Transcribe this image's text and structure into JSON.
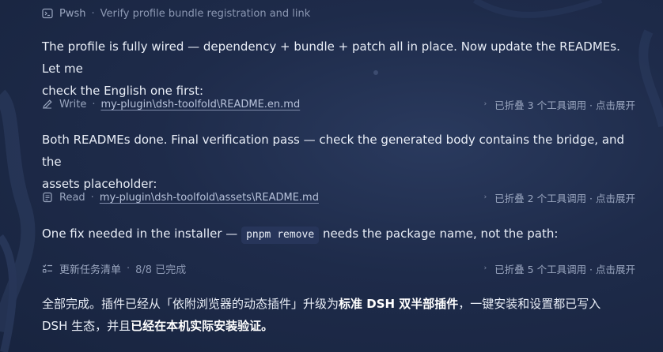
{
  "rows": {
    "pwsh": {
      "icon": "terminal-icon",
      "tool": "Pwsh",
      "sep": "·",
      "desc": "Verify profile bundle registration and link"
    },
    "write": {
      "icon": "pencil-icon",
      "tool": "Write",
      "sep": "·",
      "path": "my-plugin\\dsh-toolfold\\README.en.md",
      "fold_chevron": "›",
      "fold_text": "已折叠 3 个工具调用 · 点击展开"
    },
    "read": {
      "icon": "file-icon",
      "tool": "Read",
      "sep": "·",
      "path": "my-plugin\\dsh-toolfold\\assets\\README.md",
      "fold_chevron": "›",
      "fold_text": "已折叠 2 个工具调用 · 点击展开"
    },
    "tasks": {
      "icon": "checklist-icon",
      "tool": "更新任务清单",
      "sep": "·",
      "progress": "8/8 已完成",
      "fold_chevron": "›",
      "fold_text": "已折叠 5 个工具调用 · 点击展开"
    }
  },
  "messages": {
    "m1_line1": "The profile is fully wired — dependency + bundle + patch all in place. Now update the READMEs. Let me",
    "m1_line2": "check the English one first:",
    "m2_line1": "Both READMEs done. Final verification pass — check the generated body contains the bridge, and the",
    "m2_line2": "assets placeholder:",
    "m3_before": "One fix needed in the installer — ",
    "m3_code": "pnpm remove",
    "m3_after": " needs the package name, not the path:",
    "m4_a": "全部完成。插件已经从「依附浏览器的动态插件」升级为",
    "m4_b": "标准 DSH 双半部插件",
    "m4_c": "，一键安装和设置都已写入",
    "m4_d": "DSH 生态，并且",
    "m4_e": "已经在本机实际安装验证。"
  }
}
